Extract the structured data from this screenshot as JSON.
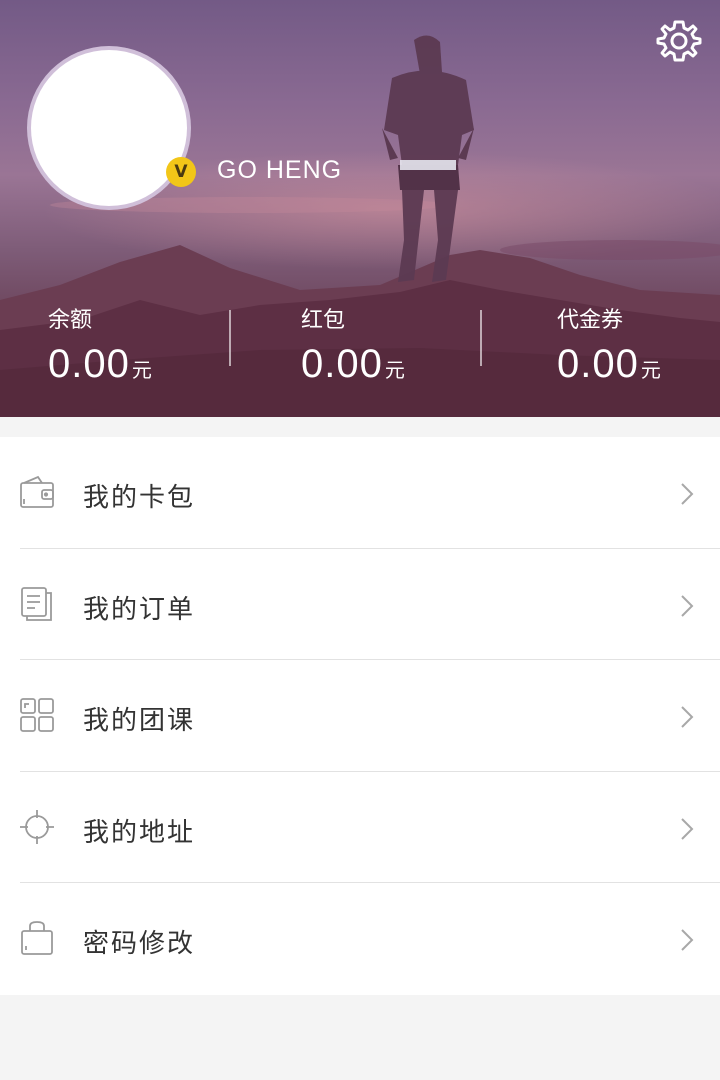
{
  "profile": {
    "username": "GO HENG",
    "vip_badge": "V"
  },
  "stats": [
    {
      "label": "余额",
      "value": "0.00",
      "unit": "元"
    },
    {
      "label": "红包",
      "value": "0.00",
      "unit": "元"
    },
    {
      "label": "代金券",
      "value": "0.00",
      "unit": "元"
    }
  ],
  "menu": [
    {
      "label": "我的卡包",
      "icon": "wallet-icon"
    },
    {
      "label": "我的订单",
      "icon": "order-list-icon"
    },
    {
      "label": "我的团课",
      "icon": "grid-icon"
    },
    {
      "label": "我的地址",
      "icon": "location-target-icon"
    },
    {
      "label": "密码修改",
      "icon": "lock-bag-icon"
    }
  ],
  "colors": {
    "header_top": "#735a86",
    "header_bottom": "#5a3142",
    "badge": "#f2c618",
    "page_background": "#f4f4f4",
    "icon_gray": "#9a9a9a"
  },
  "icons": {
    "settings": "gear-icon",
    "chevron": "chevron-right-icon"
  }
}
